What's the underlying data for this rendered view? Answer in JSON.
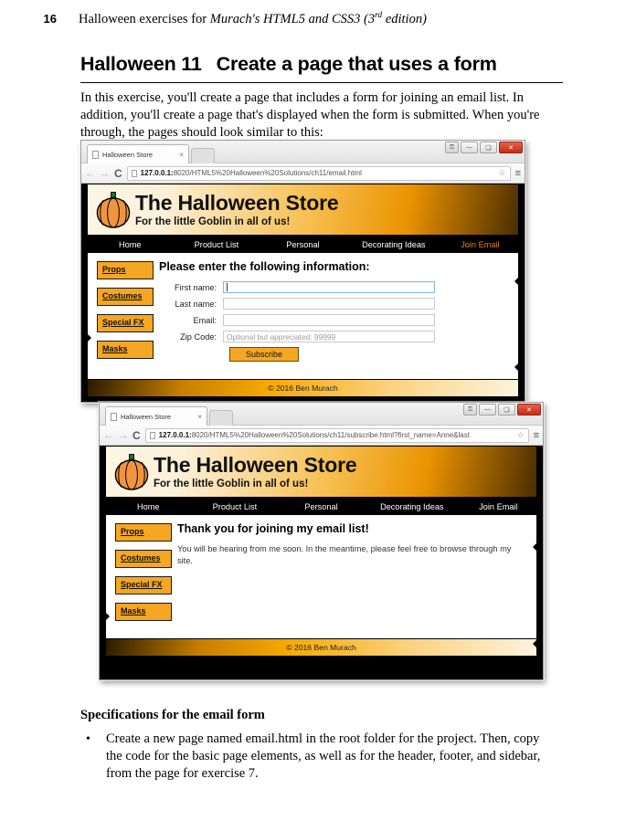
{
  "runhead": {
    "page_number": "16",
    "text_before": "Halloween exercises for ",
    "title_italic": "Murach's HTML5 and CSS3 (3",
    "sup": "rd",
    "title_italic_end": " edition)"
  },
  "heading": {
    "label": "Halloween 11",
    "title": "Create a page that uses a form"
  },
  "intro": "In this exercise, you'll create a page that includes a form for joining an email list. In addition, you'll create a page that's displayed when the form is submitted. When you're through, the pages should look similar to this:",
  "browser": {
    "tab_title": "Halloween Store",
    "tab_close": "×",
    "back_arrow": "←",
    "forward_arrow": "→",
    "reload": "C",
    "star": "☆",
    "menu": "≡",
    "win_lock": "⚿",
    "win_minimize": "—",
    "win_maximize": "❑",
    "win_close": "✕"
  },
  "window1": {
    "url_host": "127.0.0.1:",
    "url_rest": "8020/HTML5%20Halloween%20Solutions/ch11/email.html"
  },
  "window2": {
    "url_host": "127.0.0.1:",
    "url_rest": "8020/HTML5%20Halloween%20Solutions/ch11/subscribe.html?first_name=Anne&last"
  },
  "site": {
    "title": "The Halloween Store",
    "subtitle": "For the little Goblin in all of us!",
    "nav": [
      {
        "label": "Home",
        "active": false
      },
      {
        "label": "Product List",
        "active": false
      },
      {
        "label": "Personal",
        "active": false
      },
      {
        "label": "Decorating Ideas",
        "active": false
      },
      {
        "label": "Join Email",
        "active": true
      }
    ],
    "sidebar": [
      "Props",
      "Costumes",
      "Special FX",
      "Masks"
    ],
    "footer": "© 2016 Ben Murach",
    "colors": {
      "orange_button": "#F5A623",
      "nav_active": "#E8820C",
      "nav_bg": "#000000",
      "header_light": "#FDF6E6",
      "header_orange": "#EB9300"
    }
  },
  "form_page": {
    "heading": "Please enter the following information:",
    "fields": [
      {
        "label": "First name:",
        "value": "",
        "placeholder": "",
        "focused": true
      },
      {
        "label": "Last name:",
        "value": "",
        "placeholder": "",
        "focused": false
      },
      {
        "label": "Email:",
        "value": "",
        "placeholder": "",
        "focused": false
      },
      {
        "label": "Zip Code:",
        "value": "",
        "placeholder": "Optional but appreciated: 99999",
        "focused": false
      }
    ],
    "submit_label": "Subscribe"
  },
  "thankyou_page": {
    "heading": "Thank you for joining my email list!",
    "body": "You will be hearing from me soon. In the meantime, please feel free to browse through my site."
  },
  "specs": {
    "heading": "Specifications for the email form",
    "bullet_glyph": "•",
    "items": [
      "Create a new page named email.html in the root folder for the project. Then, copy the code for the basic page elements, as well as for the header, footer, and sidebar, from the page for exercise 7."
    ]
  }
}
